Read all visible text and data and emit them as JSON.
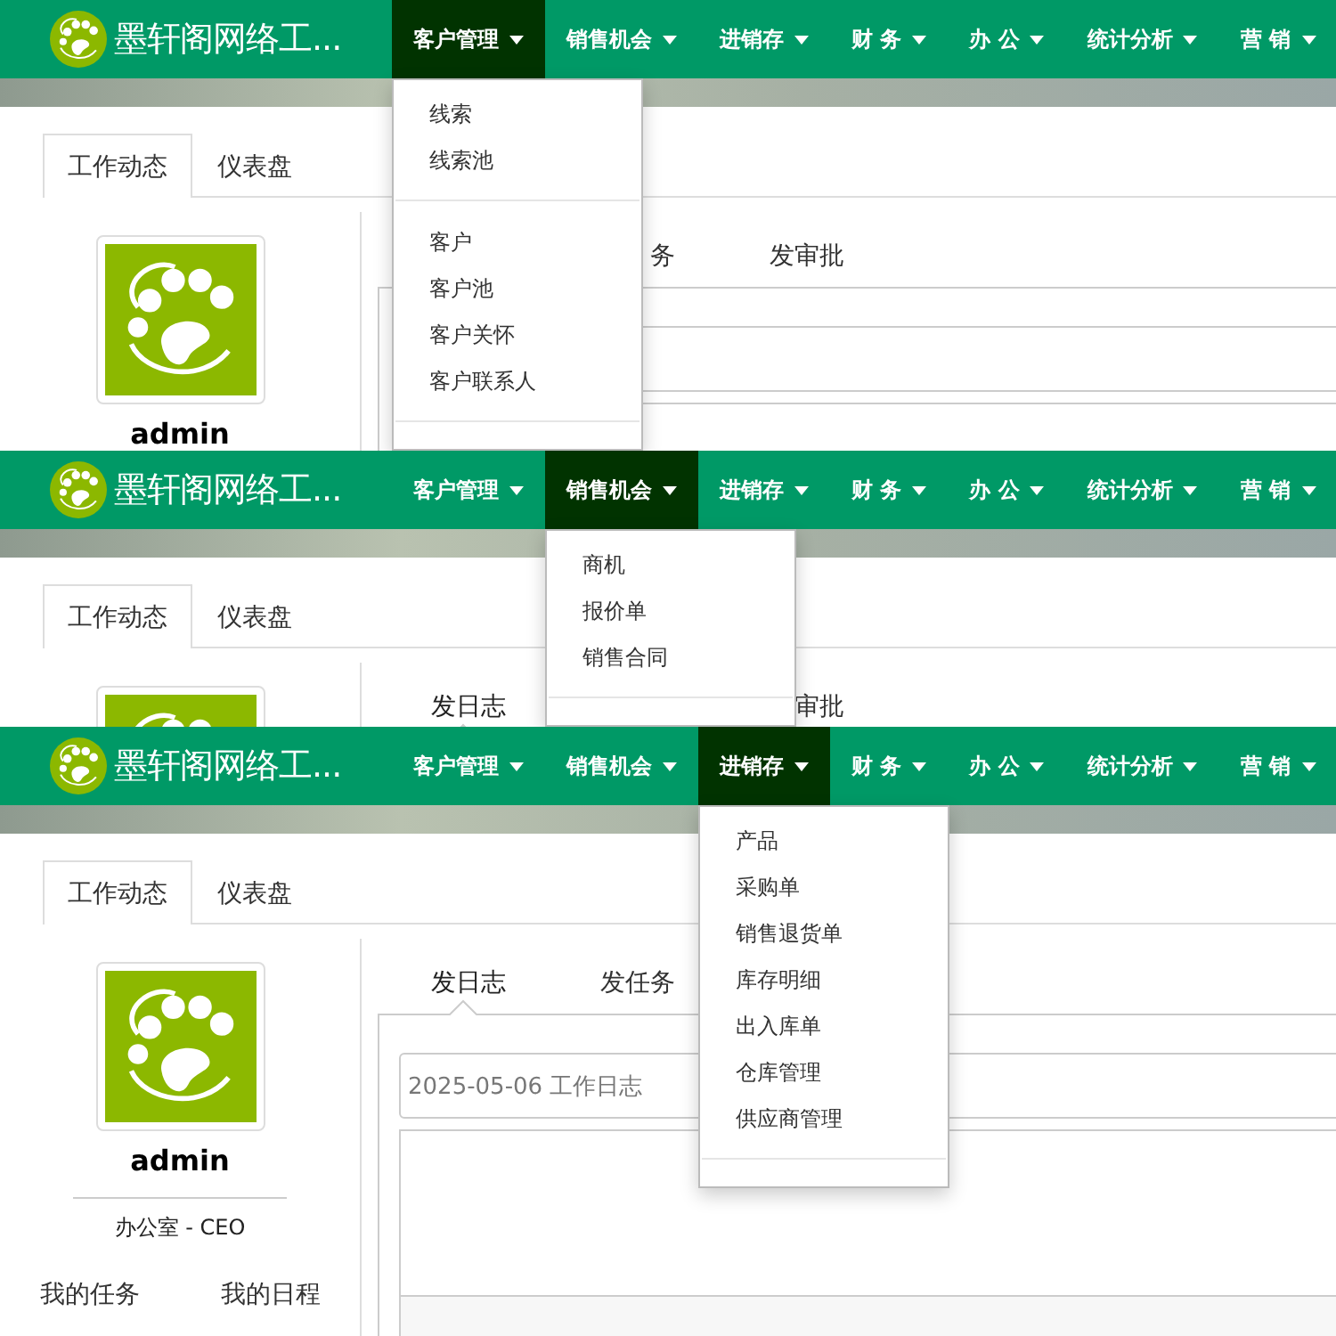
{
  "panels": [
    {
      "brand": "墨轩阁网络工...",
      "menus": [
        {
          "label": "客户管理",
          "selected": true,
          "dropdown": [
            {
              "kind": "link",
              "label": "线索"
            },
            {
              "kind": "link",
              "label": "线索池"
            },
            {
              "kind": "divider"
            },
            {
              "kind": "link",
              "label": "客户"
            },
            {
              "kind": "link",
              "label": "客户池"
            },
            {
              "kind": "link",
              "label": "客户关怀"
            },
            {
              "kind": "link",
              "label": "客户联系人"
            },
            {
              "kind": "divider"
            }
          ]
        },
        {
          "label": "销售机会",
          "selected": false
        },
        {
          "label": "进销存",
          "selected": false
        },
        {
          "label": "财 务",
          "selected": false
        },
        {
          "label": "办 公",
          "selected": false
        },
        {
          "label": "统计分析",
          "selected": false
        },
        {
          "label": "营 销",
          "selected": false
        }
      ],
      "tabs": [
        {
          "label": "工作动态",
          "selected": true
        },
        {
          "label": "仪表盘",
          "selected": false
        }
      ],
      "profile": {
        "name": "admin"
      },
      "sub_tabs": {
        "tab_2": {
          "label": "务",
          "selected": false
        },
        "tab_3": {
          "label": "发审批",
          "selected": false
        }
      }
    },
    {
      "brand": "墨轩阁网络工...",
      "menus": [
        {
          "label": "客户管理",
          "selected": false
        },
        {
          "label": "销售机会",
          "selected": true,
          "dropdown": [
            {
              "kind": "link",
              "label": "商机"
            },
            {
              "kind": "link",
              "label": "报价单"
            },
            {
              "kind": "link",
              "label": "销售合同"
            },
            {
              "kind": "divider"
            }
          ]
        },
        {
          "label": "进销存",
          "selected": false
        },
        {
          "label": "财 务",
          "selected": false
        },
        {
          "label": "办 公",
          "selected": false
        },
        {
          "label": "统计分析",
          "selected": false
        },
        {
          "label": "营 销",
          "selected": false
        }
      ],
      "tabs": [
        {
          "label": "工作动态",
          "selected": true
        },
        {
          "label": "仪表盘",
          "selected": false
        }
      ],
      "sub_tabs": {
        "tab_1": {
          "label": "发日志",
          "selected": true
        },
        "tab_3": {
          "label": "审批",
          "selected": false
        }
      }
    },
    {
      "brand": "墨轩阁网络工...",
      "menus": [
        {
          "label": "客户管理",
          "selected": false
        },
        {
          "label": "销售机会",
          "selected": false
        },
        {
          "label": "进销存",
          "selected": true,
          "dropdown": [
            {
              "kind": "link",
              "label": "产品"
            },
            {
              "kind": "link",
              "label": "采购单"
            },
            {
              "kind": "link",
              "label": "销售退货单"
            },
            {
              "kind": "link",
              "label": "库存明细"
            },
            {
              "kind": "link",
              "label": "出入库单"
            },
            {
              "kind": "link",
              "label": "仓库管理"
            },
            {
              "kind": "link",
              "label": "供应商管理"
            },
            {
              "kind": "divider"
            }
          ]
        },
        {
          "label": "财 务",
          "selected": false
        },
        {
          "label": "办 公",
          "selected": false
        },
        {
          "label": "统计分析",
          "selected": false
        },
        {
          "label": "营 销",
          "selected": false
        }
      ],
      "tabs": [
        {
          "label": "工作动态",
          "selected": true
        },
        {
          "label": "仪表盘",
          "selected": false
        }
      ],
      "profile": {
        "name": "admin",
        "role": "办公室 - CEO",
        "links": [
          "我的任务",
          "我的日程"
        ]
      },
      "sub_tabs": {
        "tab_1": {
          "label": "发日志",
          "selected": true
        },
        "tab_2": {
          "label": "发任务",
          "selected": false
        }
      },
      "log_field": {
        "value": "2025-05-06 工作日志"
      }
    }
  ]
}
